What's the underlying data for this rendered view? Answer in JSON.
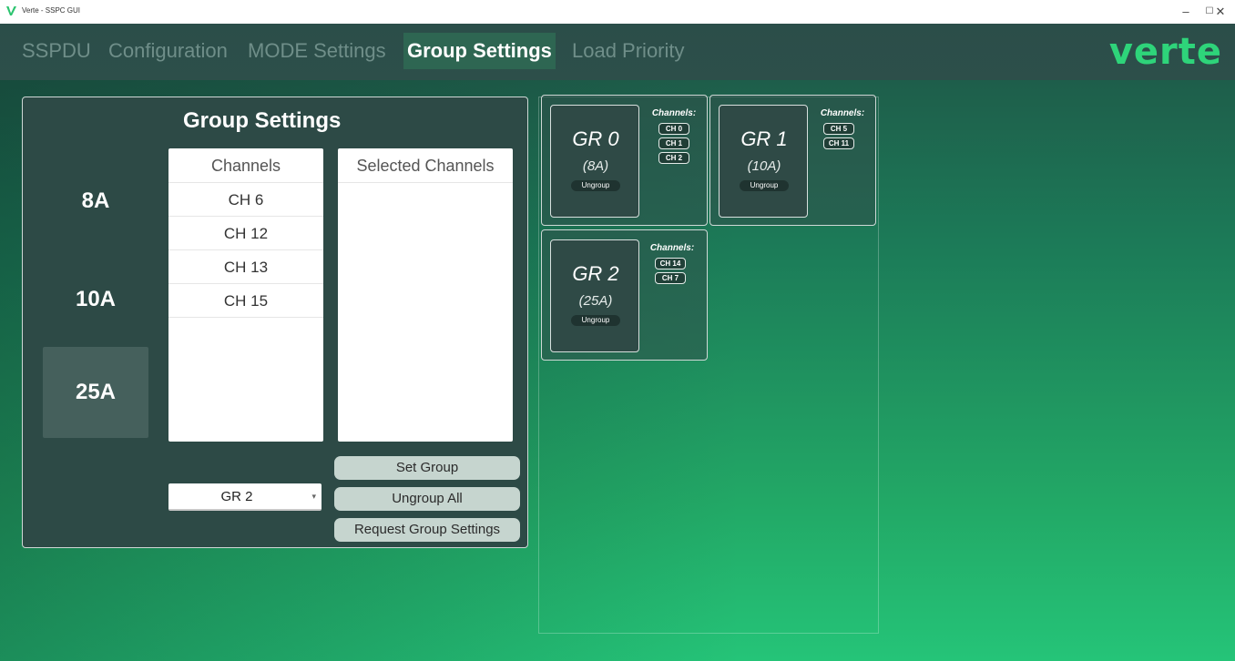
{
  "window": {
    "title": "Verte - SSPC GUI",
    "min_label": "–",
    "max_label": "☐",
    "close_label": "✕"
  },
  "tabs": [
    {
      "label": "SSPDU"
    },
    {
      "label": "Configuration"
    },
    {
      "label": "MODE Settings"
    },
    {
      "label": "Group Settings"
    },
    {
      "label": "Load Priority"
    }
  ],
  "brand": {
    "logo_text": "verte",
    "accent_color": "#2ed47a"
  },
  "group_settings": {
    "title": "Group Settings",
    "amp_options": [
      {
        "label": "8A"
      },
      {
        "label": "10A"
      },
      {
        "label": "25A"
      }
    ],
    "selected_amp": "25A",
    "channels_list": {
      "header": "Channels",
      "items": [
        "CH 6",
        "CH 12",
        "CH 13",
        "CH 15"
      ]
    },
    "selected_channels_list": {
      "header": "Selected Channels",
      "items": []
    },
    "group_select": {
      "value": "GR 2"
    },
    "buttons": {
      "set_group": "Set Group",
      "ungroup_all": "Ungroup All",
      "request": "Request Group Settings"
    }
  },
  "groups": [
    {
      "name": "GR 0",
      "amp": "(8A)",
      "ungroup_label": "Ungroup",
      "channels_label": "Channels:",
      "channels": [
        "CH 0",
        "CH 1",
        "CH 2"
      ]
    },
    {
      "name": "GR 1",
      "amp": "(10A)",
      "ungroup_label": "Ungroup",
      "channels_label": "Channels:",
      "channels": [
        "CH 5",
        "CH 11"
      ]
    },
    {
      "name": "GR 2",
      "amp": "(25A)",
      "ungroup_label": "Ungroup",
      "channels_label": "Channels:",
      "channels": [
        "CH 14",
        "CH 7"
      ]
    }
  ]
}
